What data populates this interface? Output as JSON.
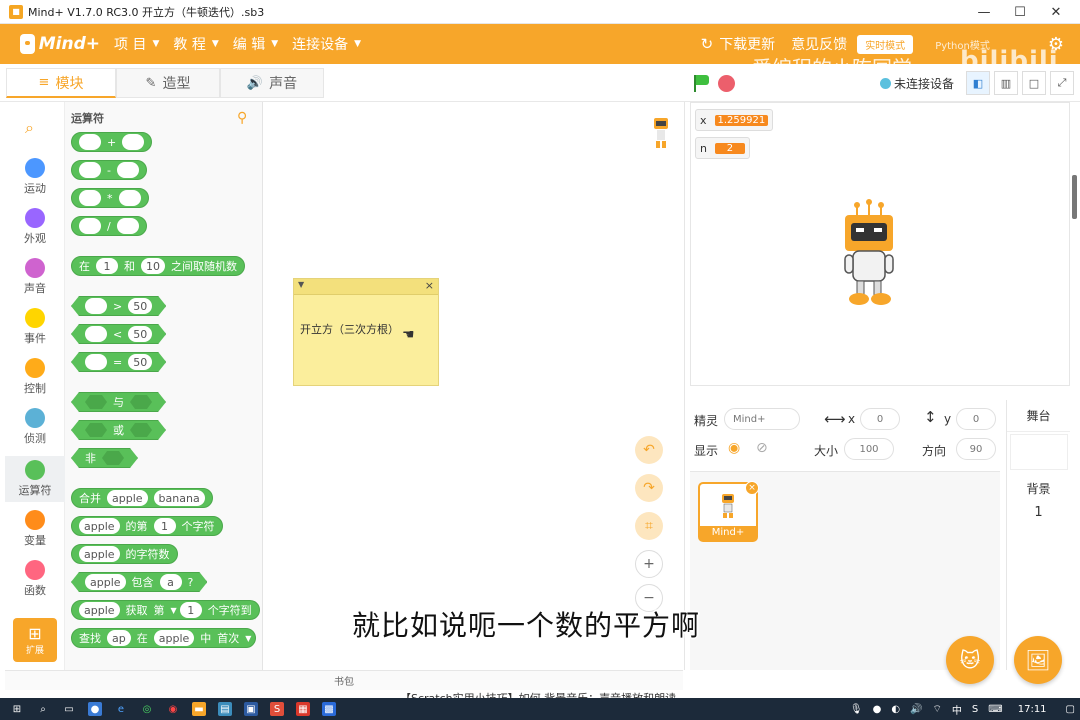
{
  "window": {
    "title": "Mind+ V1.7.0 RC3.0   开立方（牛顿迭代）.sb3",
    "controls": [
      "—",
      "☐",
      "✕"
    ]
  },
  "menubar": {
    "logo": "Mind+",
    "items": [
      "项 目",
      "教 程",
      "编 辑",
      "连接设备"
    ],
    "download_label": "下载更新",
    "feedback_label": "意见反馈",
    "mode_button": "实时模式",
    "python_mode": "Python模式",
    "watermark": "爱编程的小陈同学",
    "bili_mark": "bilibili"
  },
  "tabs": [
    {
      "icon": "≡",
      "label": "模块"
    },
    {
      "icon": "✎",
      "label": "造型"
    },
    {
      "icon": "🔊",
      "label": "声音"
    }
  ],
  "connect_status": "未连接设备",
  "categories": [
    {
      "label": "运动",
      "color": "#4c97ff"
    },
    {
      "label": "外观",
      "color": "#9966ff"
    },
    {
      "label": "声音",
      "color": "#cf63cf"
    },
    {
      "label": "事件",
      "color": "#ffd500"
    },
    {
      "label": "控制",
      "color": "#ffab19"
    },
    {
      "label": "侦测",
      "color": "#5cb1d6"
    },
    {
      "label": "运算符",
      "color": "#59c059"
    },
    {
      "label": "变量",
      "color": "#ff8c1a"
    },
    {
      "label": "函数",
      "color": "#ff6680"
    }
  ],
  "extension_label": "扩展",
  "palette": {
    "title": "运算符",
    "ops": [
      "+",
      "-",
      "*",
      "/"
    ],
    "random": {
      "prefix": "在",
      "from": "1",
      "mid": "和",
      "to": "10",
      "suffix": "之间取随机数"
    },
    "compare": [
      {
        "op": ">",
        "value": "50"
      },
      {
        "op": "<",
        "value": "50"
      },
      {
        "op": "=",
        "value": "50"
      }
    ],
    "logic": [
      "与",
      "或",
      "非"
    ],
    "join": {
      "label": "合并",
      "a": "apple",
      "b": "banana"
    },
    "letter_of": {
      "a": "apple",
      "mid": "的第",
      "n": "1",
      "suffix": "个字符"
    },
    "length_of": {
      "a": "apple",
      "suffix": "的字符数"
    },
    "contains": {
      "a": "apple",
      "mid": "包含",
      "b": "a",
      "suffix": "?"
    },
    "get": {
      "a": "apple",
      "mid": "获取",
      "pos": "第",
      "n": "1",
      "suffix": "个字符到"
    },
    "find": {
      "label": "查找",
      "a": "ap",
      "mid": "在",
      "b": "apple",
      "mid2": "中",
      "pos": "首次"
    }
  },
  "note": {
    "text": "开立方（三次方根）"
  },
  "backpack_label": "书包",
  "backpack_under": "【Scratch实用小技巧】如何 背景音乐：声音播放和朗读...",
  "variables": [
    {
      "name": "x",
      "value": "1.259921"
    },
    {
      "name": "n",
      "value": "2"
    }
  ],
  "sprite_info": {
    "sprite_label": "精灵",
    "sprite_name": "Mind+",
    "x_label": "x",
    "x_value": "0",
    "y_label": "y",
    "y_value": "0",
    "show_label": "显示",
    "size_label": "大小",
    "size_value": "100",
    "direction_label": "方向",
    "direction_value": "90"
  },
  "sprite_card": {
    "label": "Mind+"
  },
  "stage_panel": {
    "header": "舞台",
    "backdrop_label": "背景",
    "backdrop_count": "1"
  },
  "subtitle": "就比如说呃一个数的平方啊",
  "taskbar": {
    "clock": "17:11",
    "ime": "中",
    "lang": "S"
  }
}
